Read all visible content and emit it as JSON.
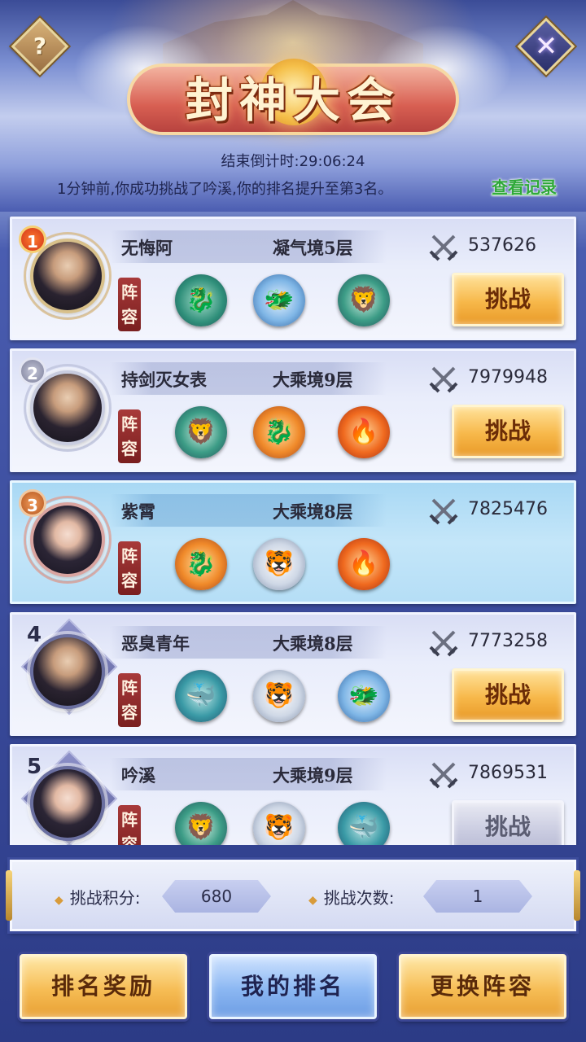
{
  "header": {
    "title": "封神大会",
    "help_icon": "?",
    "close_icon": "✕",
    "countdown_label": "结束倒计时:",
    "countdown_value": "29:06:24",
    "notice": "1分钟前,你成功挑战了吟溪,你的排名提升至第3名。",
    "view_log": "查看记录"
  },
  "lineup_label_1": "阵",
  "lineup_label_2": "容",
  "challenge_label": "挑战",
  "entries": [
    {
      "rank": "1",
      "name": "无悔阿",
      "realm": "凝气境5层",
      "power": "537626",
      "beasts": [
        "dragon-jade-icon",
        "dragon-azure-icon",
        "qilin-green-icon"
      ]
    },
    {
      "rank": "2",
      "name": "持剑灭女表",
      "realm": "大乘境9层",
      "power": "7979948",
      "beasts": [
        "qilin-green-icon",
        "dragon-golden-icon",
        "phoenix-icon"
      ]
    },
    {
      "rank": "3",
      "name": "紫霄",
      "realm": "大乘境8层",
      "power": "7825476",
      "beasts": [
        "dragon-golden-icon",
        "white-tiger-icon",
        "phoenix-icon"
      ]
    },
    {
      "rank": "4",
      "name": "恶臭青年",
      "realm": "大乘境8层",
      "power": "7773258",
      "beasts": [
        "black-tortoise-icon",
        "white-tiger-icon",
        "dragon-azure-icon"
      ]
    },
    {
      "rank": "5",
      "name": "吟溪",
      "realm": "大乘境9层",
      "power": "7869531",
      "beasts": [
        "qilin-green-icon",
        "white-tiger-icon",
        "black-tortoise-icon"
      ]
    }
  ],
  "points": {
    "score_label": "挑战积分:",
    "score_value": "680",
    "count_label": "挑战次数:",
    "count_value": "1"
  },
  "buttons": {
    "rank_reward": "排名奖励",
    "my_rank": "我的排名",
    "change_lineup": "更换阵容"
  },
  "colors": {
    "accent_gold": "#f7b84a",
    "highlight_row": "#b5def6",
    "link_green": "#2ea838"
  }
}
